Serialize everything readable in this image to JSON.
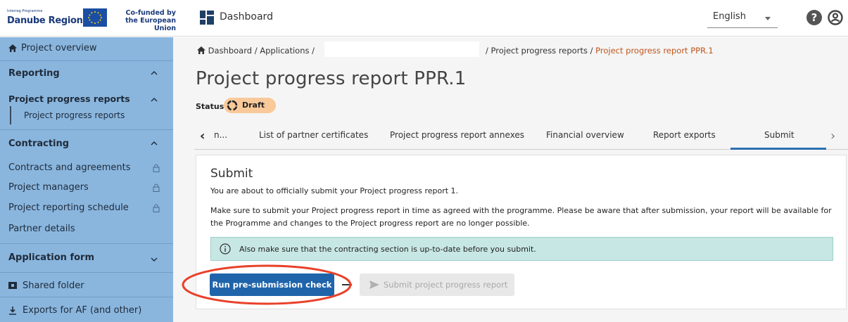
{
  "header": {
    "logo_small": "Interreg Programme",
    "logo_region": "Danube Region",
    "logo_eu": "Co-funded by the European Union",
    "title": "Dashboard",
    "language": "English"
  },
  "sidebar": {
    "project_overview": "Project overview",
    "reporting": "Reporting",
    "ppr_group": "Project progress reports",
    "ppr_item": "Project progress reports",
    "contracting": "Contracting",
    "contracts": "Contracts and agreements",
    "managers": "Project managers",
    "schedule": "Project reporting schedule",
    "partner_details": "Partner details",
    "application_form": "Application form",
    "shared_folder": "Shared folder",
    "exports": "Exports for AF (and other)"
  },
  "breadcrumb": {
    "dashboard": "Dashboard",
    "applications": "Applications",
    "ppr": "Project progress reports",
    "current": "Project progress report PPR.1"
  },
  "page": {
    "title": "Project progress report PPR.1",
    "status_label": "Status",
    "status_value": "Draft"
  },
  "tabs": {
    "truncated": "n...",
    "certificates": "List of partner certificates",
    "annexes": "Project progress report annexes",
    "financial": "Financial overview",
    "exports": "Report exports",
    "submit": "Submit"
  },
  "submit": {
    "title": "Submit",
    "intro": "You are about to officially submit your Project progress report 1.",
    "notice": "Make sure to submit your Project progress report in time as agreed with the programme. Please be aware that after submission, your report will be available for the Programme and changes to the Project progress report are no longer possible.",
    "info": "Also make sure that the contracting section is up-to-date before you submit.",
    "run_check": "Run pre-submission check",
    "submit_btn": "Submit project progress report"
  },
  "colors": {
    "sidebar_bg": "#8ab6de",
    "primary": "#1f64aa",
    "status_draft": "#f9c99a",
    "info_bg": "#c7e7e4",
    "breadcrumb_active": "#c0551c",
    "highlight_ring": "#e8412a"
  }
}
